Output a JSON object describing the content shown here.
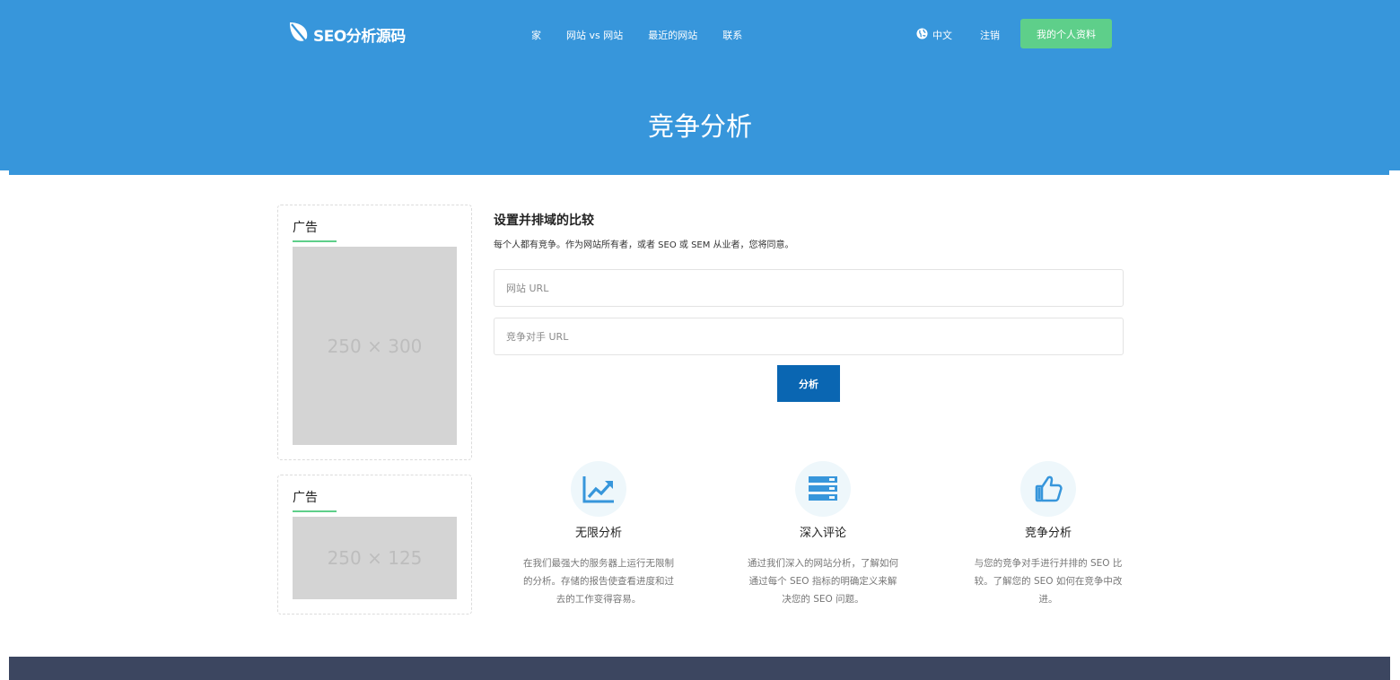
{
  "colors": {
    "primary": "#3796db",
    "accent_green": "#5ecf8a",
    "button_blue": "#0a66b2",
    "footer": "#3c4660"
  },
  "header": {
    "logo_text": "SEO分析源码",
    "logo_icon": "leaf-icon",
    "nav": [
      "家",
      "网站 vs 网站",
      "最近的网站",
      "联系"
    ],
    "language": "中文",
    "language_icon": "globe-icon",
    "logout": "注销",
    "profile": "我的个人资料"
  },
  "hero": {
    "title": "竞争分析"
  },
  "ads": [
    {
      "title": "广告",
      "placeholder": "250 × 300"
    },
    {
      "title": "广告",
      "placeholder": "250 × 125"
    }
  ],
  "form": {
    "title": "设置并排域的比较",
    "subtitle": "每个人都有竞争。作为网站所有者，或者 SEO 或 SEM 从业者，您将同意。",
    "site_placeholder": "网站 URL",
    "competitor_placeholder": "竞争对手 URL",
    "submit": "分析"
  },
  "features": [
    {
      "icon": "chart-trend-icon",
      "title": "无限分析",
      "desc": "在我们最强大的服务器上运行无限制的分析。存储的报告使查看进度和过去的工作变得容易。"
    },
    {
      "icon": "server-icon",
      "title": "深入评论",
      "desc": "通过我们深入的网站分析，了解如何通过每个 SEO 指标的明确定义来解决您的 SEO 问题。"
    },
    {
      "icon": "thumbs-up-icon",
      "title": "竞争分析",
      "desc": "与您的竞争对手进行并排的 SEO 比较。了解您的 SEO 如何在竞争中改进。"
    }
  ]
}
